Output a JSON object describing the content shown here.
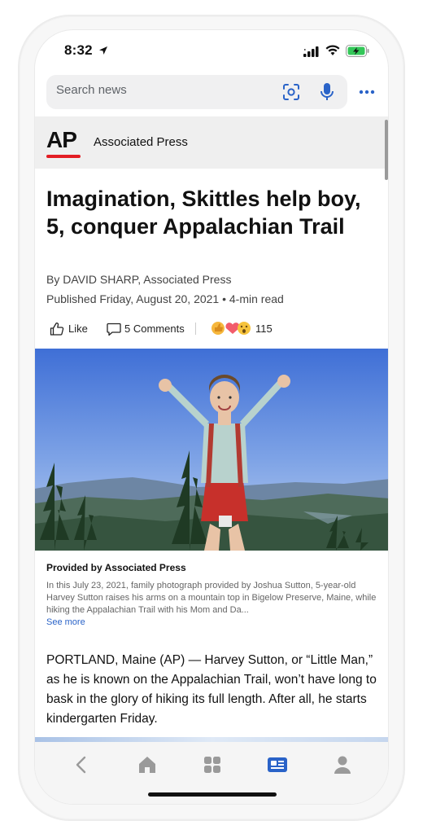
{
  "status_bar": {
    "time": "8:32"
  },
  "search": {
    "placeholder": "Search news"
  },
  "publisher": {
    "logo_text": "AP",
    "name": "Associated Press"
  },
  "article": {
    "headline": "Imagination, Skittles help boy, 5, conquer Appalachian Trail",
    "byline": "By DAVID SHARP, Associated Press",
    "published": "Published Friday, August 20, 2021 • 4-min read",
    "actions": {
      "like_label": "Like",
      "comments_label": "5 Comments",
      "reaction_count": "115"
    },
    "photo": {
      "credit": "Provided by Associated Press",
      "caption": "In this July 23, 2021, family photograph provided by Joshua Sutton, 5-year-old Harvey Sutton raises his arms on a mountain top in Bigelow Preserve, Maine, while hiking the Appalachian Trail with his Mom and Da...",
      "see_more": "See more"
    },
    "body": "PORTLAND, Maine (AP) — Harvey Sutton, or “Little Man,” as he is known on the Appalachian Trail, won’t have long to bask in the glory of hiking its full length. After all, he starts kindergarten Friday."
  },
  "bottom_nav": {
    "items": [
      "back-icon",
      "home-icon",
      "apps-grid-icon",
      "news-icon",
      "profile-icon"
    ],
    "active": "news-icon"
  },
  "colors": {
    "accent": "#2a63c8",
    "ap_red": "#e31e24",
    "battery_green": "#34c759"
  }
}
